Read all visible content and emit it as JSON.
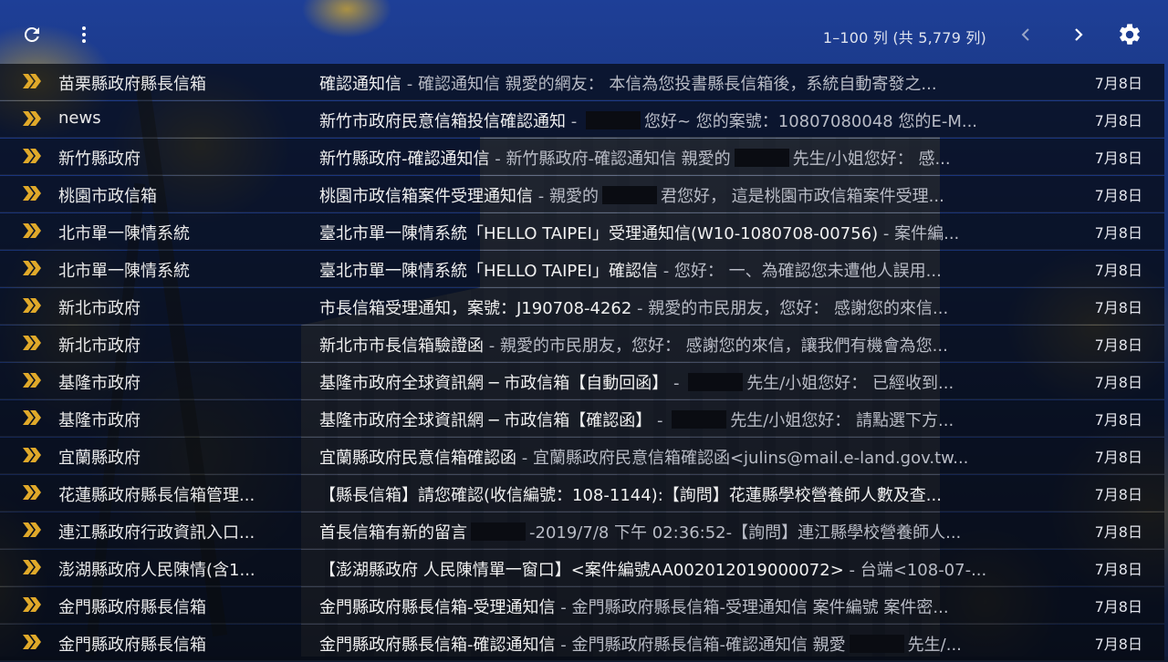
{
  "toolbar": {
    "refresh_icon": "refresh-icon",
    "more_icon": "more-vert-icon",
    "pager_text": "1–100 列 (共 5,779 列)",
    "prev_icon": "chevron-left-icon",
    "next_icon": "chevron-right-icon",
    "settings_icon": "gear-icon"
  },
  "colors": {
    "important_marker": "#e0a92a",
    "row_background": "rgba(6,8,14,0.72)",
    "snippet_text": "#b9bcc6"
  },
  "emails": [
    {
      "sender": "苗栗縣政府縣長信箱",
      "subject": "確認通知信",
      "sep": " - ",
      "pre": "確認通知信 親愛的網友： 本信為您投書縣長信箱後，系統自動寄發之...",
      "redacted": false,
      "post": "",
      "date": "7月8日"
    },
    {
      "sender": "news",
      "subject": "新竹市政府民意信箱投信確認通知",
      "sep": " - ",
      "pre": "",
      "redacted": true,
      "post": "您好~ 您的案號：10807080048 您的E-M...",
      "date": "7月8日"
    },
    {
      "sender": "新竹縣政府",
      "subject": "新竹縣政府-確認通知信",
      "sep": " - ",
      "pre": "新竹縣政府-確認通知信 親愛的",
      "redacted": true,
      "post": "先生/小姐您好： 感...",
      "date": "7月8日"
    },
    {
      "sender": "桃園市政信箱",
      "subject": "桃園市政信箱案件受理通知信",
      "sep": " - ",
      "pre": "親愛的",
      "redacted": true,
      "post": "君您好， 這是桃園市政信箱案件受理...",
      "date": "7月8日"
    },
    {
      "sender": "北市單一陳情系統",
      "subject": "臺北市單一陳情系統「HELLO TAIPEI」受理通知信(W10-1080708-00756)",
      "sep": " - ",
      "pre": "案件編...",
      "redacted": false,
      "post": "",
      "date": "7月8日"
    },
    {
      "sender": "北市單一陳情系統",
      "subject": "臺北市單一陳情系統「HELLO TAIPEI」確認信",
      "sep": " - ",
      "pre": "您好： 一、為確認您未遭他人誤用...",
      "redacted": false,
      "post": "",
      "date": "7月8日"
    },
    {
      "sender": "新北市政府",
      "subject": "市長信箱受理通知，案號：J190708-4262",
      "sep": " - ",
      "pre": "親愛的市民朋友，您好： 感謝您的來信...",
      "redacted": false,
      "post": "",
      "date": "7月8日"
    },
    {
      "sender": "新北市政府",
      "subject": "新北市市長信箱驗證函",
      "sep": " - ",
      "pre": "親愛的市民朋友，您好： 感謝您的來信，讓我們有機會為您...",
      "redacted": false,
      "post": "",
      "date": "7月8日"
    },
    {
      "sender": "基隆市政府",
      "subject": "基隆市政府全球資訊網 ─ 市政信箱【自動回函】",
      "sep": " - ",
      "pre": "",
      "redacted": true,
      "post": "先生/小姐您好： 已經收到...",
      "date": "7月8日"
    },
    {
      "sender": "基隆市政府",
      "subject": "基隆市政府全球資訊網 ─ 市政信箱【確認函】",
      "sep": " - ",
      "pre": "",
      "redacted": true,
      "post": "先生/小姐您好： 請點選下方...",
      "date": "7月8日"
    },
    {
      "sender": "宜蘭縣政府",
      "subject": "宜蘭縣政府民意信箱確認函",
      "sep": " - ",
      "pre": "宜蘭縣政府民意信箱確認函<julins@mail.e-land.gov.tw...",
      "redacted": false,
      "post": "",
      "date": "7月8日"
    },
    {
      "sender": "花蓮縣政府縣長信箱管理...",
      "subject": "【縣長信箱】請您確認(收信編號：108-1144):【詢問】花蓮縣學校營養師人數及查...",
      "sep": "",
      "pre": "",
      "redacted": false,
      "post": "",
      "date": "7月8日"
    },
    {
      "sender": "連江縣政府行政資訊入口...",
      "subject": "首長信箱有新的留言",
      "sep": "",
      "pre": "",
      "redacted": true,
      "post": "-2019/7/8 下午 02:36:52-【詢問】連江縣學校營養師人...",
      "date": "7月8日"
    },
    {
      "sender": "澎湖縣政府人民陳情(含1...",
      "subject": "【澎湖縣政府 人民陳情單一窗口】<案件編號AA002012019000072>",
      "sep": " - ",
      "pre": "台端<108-07-...",
      "redacted": false,
      "post": "",
      "date": "7月8日"
    },
    {
      "sender": "金門縣政府縣長信箱",
      "subject": "金門縣政府縣長信箱-受理通知信",
      "sep": " - ",
      "pre": "金門縣政府縣長信箱-受理通知信 案件編號 案件密...",
      "redacted": false,
      "post": "",
      "date": "7月8日"
    },
    {
      "sender": "金門縣政府縣長信箱",
      "subject": "金門縣政府縣長信箱-確認通知信",
      "sep": " - ",
      "pre": "金門縣政府縣長信箱-確認通知信 親愛",
      "redacted": true,
      "post": "先生/...",
      "date": "7月8日"
    }
  ]
}
